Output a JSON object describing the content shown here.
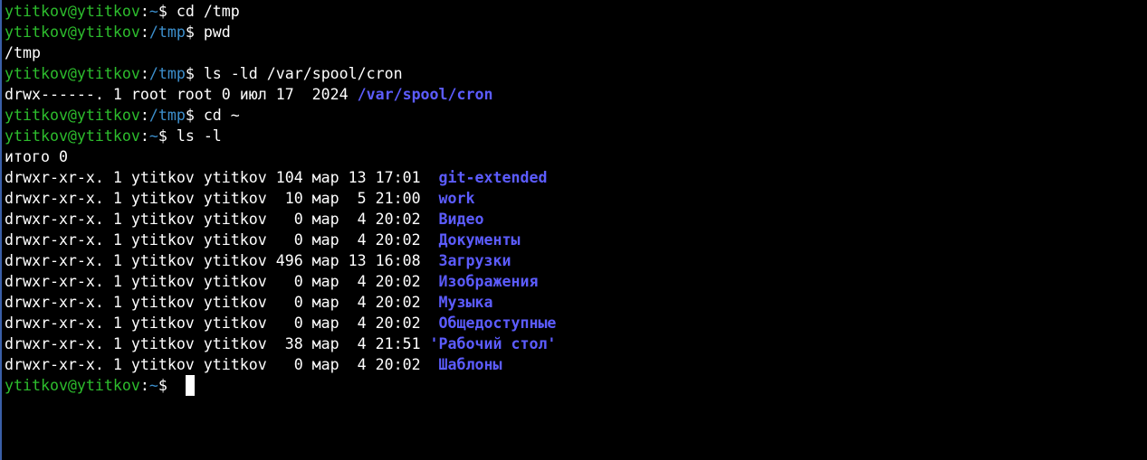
{
  "colors": {
    "background": "#000000",
    "prompt_user": "#2dbd2d",
    "prompt_path": "#3c8fcd",
    "directory": "#5c5cff",
    "text": "#ffffff"
  },
  "prompt": {
    "user_host": "ytitkov@ytitkov",
    "separator": ":",
    "dollar": "$"
  },
  "session": [
    {
      "type": "cmd",
      "path": "~",
      "command": " cd /tmp"
    },
    {
      "type": "cmd",
      "path": "/tmp",
      "command": " pwd"
    },
    {
      "type": "out",
      "text": "/tmp"
    },
    {
      "type": "cmd",
      "path": "/tmp",
      "command": " ls -ld /var/spool/cron"
    },
    {
      "type": "ls",
      "meta": "drwx------. 1 root root 0 июл 17  2024 ",
      "name": "/var/spool/cron"
    },
    {
      "type": "cmd",
      "path": "/tmp",
      "command": " cd ~"
    },
    {
      "type": "cmd",
      "path": "~",
      "command": " ls -l"
    },
    {
      "type": "out",
      "text": "итого 0"
    },
    {
      "type": "ls",
      "meta": "drwxr-xr-x. 1 ytitkov ytitkov 104 мар 13 17:01  ",
      "name": "git-extended"
    },
    {
      "type": "ls",
      "meta": "drwxr-xr-x. 1 ytitkov ytitkov  10 мар  5 21:00  ",
      "name": "work"
    },
    {
      "type": "ls",
      "meta": "drwxr-xr-x. 1 ytitkov ytitkov   0 мар  4 20:02  ",
      "name": "Видео"
    },
    {
      "type": "ls",
      "meta": "drwxr-xr-x. 1 ytitkov ytitkov   0 мар  4 20:02  ",
      "name": "Документы"
    },
    {
      "type": "ls",
      "meta": "drwxr-xr-x. 1 ytitkov ytitkov 496 мар 13 16:08  ",
      "name": "Загрузки"
    },
    {
      "type": "ls",
      "meta": "drwxr-xr-x. 1 ytitkov ytitkov   0 мар  4 20:02  ",
      "name": "Изображения"
    },
    {
      "type": "ls",
      "meta": "drwxr-xr-x. 1 ytitkov ytitkov   0 мар  4 20:02  ",
      "name": "Музыка"
    },
    {
      "type": "ls",
      "meta": "drwxr-xr-x. 1 ytitkov ytitkov   0 мар  4 20:02  ",
      "name": "Общедоступные"
    },
    {
      "type": "ls",
      "meta": "drwxr-xr-x. 1 ytitkov ytitkov  38 мар  4 21:51 ",
      "name": "'Рабочий стол'"
    },
    {
      "type": "ls",
      "meta": "drwxr-xr-x. 1 ytitkov ytitkov   0 мар  4 20:02  ",
      "name": "Шаблоны"
    },
    {
      "type": "cmd",
      "path": "~",
      "command": " ",
      "cursor": true
    }
  ]
}
